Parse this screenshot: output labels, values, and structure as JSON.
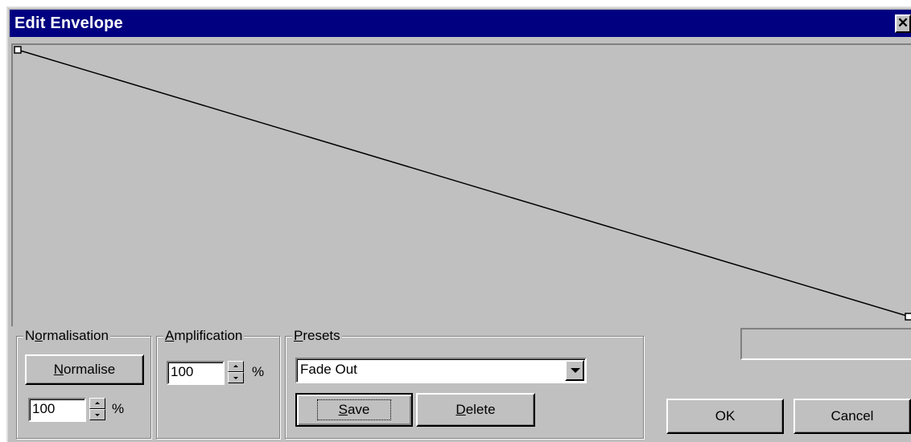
{
  "window": {
    "title": "Edit Envelope",
    "close_symbol": "✕",
    "close_icon": "close-icon"
  },
  "envelope": {
    "points": [
      {
        "x": 0.0,
        "level": 1.0
      },
      {
        "x": 1.0,
        "level": 0.0
      }
    ]
  },
  "normalisation": {
    "group_label": "Normalisation",
    "button_label": "Normalise",
    "value": "100",
    "unit": "%"
  },
  "amplification": {
    "group_label": "Amplification",
    "value": "100",
    "unit": "%"
  },
  "presets": {
    "group_label": "Presets",
    "selected": "Fade Out",
    "save_label": "Save",
    "delete_label": "Delete"
  },
  "buttons": {
    "ok_label": "OK",
    "cancel_label": "Cancel"
  },
  "colors": {
    "title_bar": "#000080",
    "face": "#c0c0c0"
  }
}
